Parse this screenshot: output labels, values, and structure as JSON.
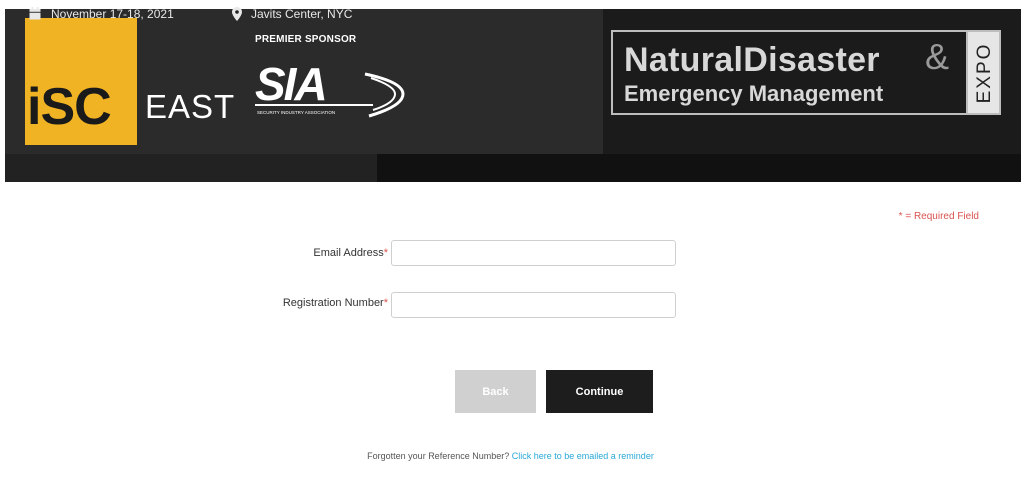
{
  "header": {
    "isc_logo": {
      "isc": "iSC",
      "east": "EAST"
    },
    "sponsor_label": "PREMIER SPONSOR",
    "sia_logo": {
      "mark": "SIA",
      "subtitle": "SECURITY INDUSTRY ASSOCIATION"
    },
    "nde_logo": {
      "title_part1": "Natural",
      "title_part2": "Disaster",
      "ampersand": "&",
      "subtitle": "Emergency Management",
      "side": "EXPO"
    }
  },
  "info_bar": {
    "date": "November 17-18, 2021",
    "location": "Javits Center, NYC",
    "calendar_icon": "calendar-icon",
    "location_icon": "map-marker-icon"
  },
  "form": {
    "required_note": "* = Required Field",
    "email_label": "Email Address",
    "email_value": "",
    "registration_label": "Registration Number",
    "registration_value": "",
    "required_marker": "*"
  },
  "buttons": {
    "back": "Back",
    "continue": "Continue"
  },
  "footer": {
    "forgot_text": "Forgotten your Reference Number?",
    "forgot_link": "Click here to be emailed a reminder"
  },
  "colors": {
    "brand_yellow": "#f0b323",
    "banner_dark": "#2b2b2b",
    "required_red": "#d9534f",
    "link_blue": "#2aa8d8",
    "button_dark": "#1d1d1d",
    "button_disabled": "#d0d0d0"
  }
}
